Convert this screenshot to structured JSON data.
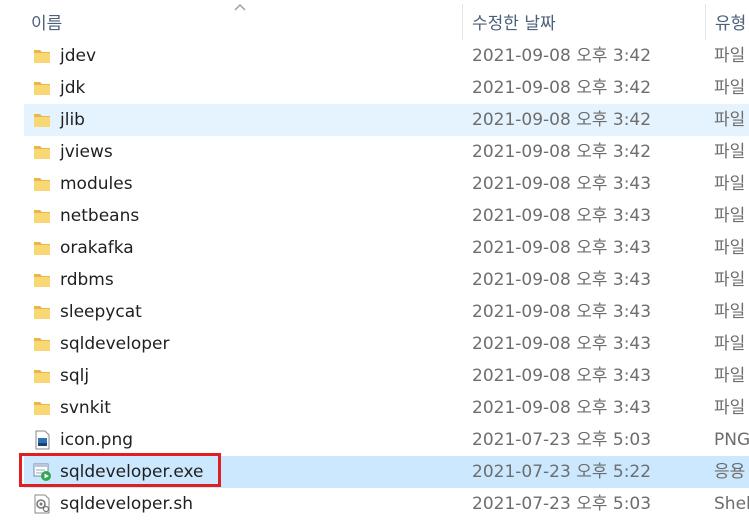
{
  "columns": {
    "name": "이름",
    "date": "수정한 날짜",
    "type": "유형"
  },
  "files": [
    {
      "name": "jdev",
      "date": "2021-09-08 오후 3:42",
      "type": "파일",
      "icon": "folder-icon",
      "state": ""
    },
    {
      "name": "jdk",
      "date": "2021-09-08 오후 3:42",
      "type": "파일",
      "icon": "folder-icon",
      "state": ""
    },
    {
      "name": "jlib",
      "date": "2021-09-08 오후 3:42",
      "type": "파일",
      "icon": "folder-icon",
      "state": "hover"
    },
    {
      "name": "jviews",
      "date": "2021-09-08 오후 3:42",
      "type": "파일",
      "icon": "folder-icon",
      "state": ""
    },
    {
      "name": "modules",
      "date": "2021-09-08 오후 3:43",
      "type": "파일",
      "icon": "folder-icon",
      "state": ""
    },
    {
      "name": "netbeans",
      "date": "2021-09-08 오후 3:43",
      "type": "파일",
      "icon": "folder-icon",
      "state": ""
    },
    {
      "name": "orakafka",
      "date": "2021-09-08 오후 3:43",
      "type": "파일",
      "icon": "folder-icon",
      "state": ""
    },
    {
      "name": "rdbms",
      "date": "2021-09-08 오후 3:43",
      "type": "파일",
      "icon": "folder-icon",
      "state": ""
    },
    {
      "name": "sleepycat",
      "date": "2021-09-08 오후 3:43",
      "type": "파일",
      "icon": "folder-icon",
      "state": ""
    },
    {
      "name": "sqldeveloper",
      "date": "2021-09-08 오후 3:43",
      "type": "파일",
      "icon": "folder-icon",
      "state": ""
    },
    {
      "name": "sqlj",
      "date": "2021-09-08 오후 3:43",
      "type": "파일",
      "icon": "folder-icon",
      "state": ""
    },
    {
      "name": "svnkit",
      "date": "2021-09-08 오후 3:43",
      "type": "파일",
      "icon": "folder-icon",
      "state": ""
    },
    {
      "name": "icon.png",
      "date": "2021-07-23 오후 5:03",
      "type": "PNG",
      "icon": "image-file-icon",
      "state": ""
    },
    {
      "name": "sqldeveloper.exe",
      "date": "2021-07-23 오후 5:22",
      "type": "응용",
      "icon": "exe-app-icon",
      "state": "selected"
    },
    {
      "name": "sqldeveloper.sh",
      "date": "2021-07-23 오후 5:03",
      "type": "Shel",
      "icon": "shell-script-icon",
      "state": ""
    }
  ],
  "colors": {
    "selected": "#cce8ff",
    "hover": "#e5f3ff",
    "highlight_box": "#e02020",
    "folder": "#f8d775"
  }
}
